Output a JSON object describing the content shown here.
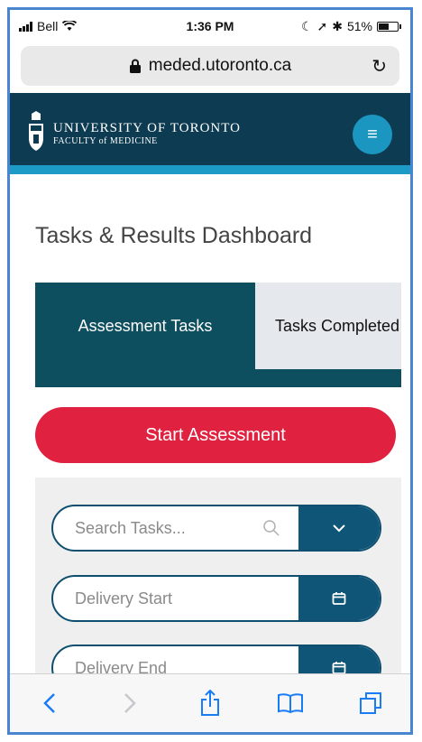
{
  "status_bar": {
    "carrier": "Bell",
    "time": "1:36 PM",
    "battery": "51%"
  },
  "browser": {
    "url": "meded.utoronto.ca"
  },
  "header": {
    "org_name": "UNIVERSITY OF TORONTO",
    "org_sub": "FACULTY of MEDICINE"
  },
  "page": {
    "title": "Tasks & Results Dashboard"
  },
  "tabs": [
    {
      "label": "Assessment Tasks",
      "active": true
    },
    {
      "label": "Tasks Completed",
      "active": false
    }
  ],
  "actions": {
    "start_label": "Start Assessment"
  },
  "filters": {
    "search_placeholder": "Search Tasks...",
    "delivery_start_placeholder": "Delivery Start",
    "delivery_end_placeholder": "Delivery End"
  },
  "colors": {
    "header": "#0d3b52",
    "accent": "#1b9bc6",
    "primary_button": "#e0213f",
    "tab_active": "#0e4f5f"
  },
  "icons": [
    "wifi-icon",
    "lock-icon",
    "reload-icon",
    "crest-icon",
    "menu-icon",
    "search-icon",
    "chevron-down-icon",
    "calendar-icon",
    "back-icon",
    "forward-icon",
    "share-icon",
    "bookmarks-icon",
    "tabs-icon"
  ]
}
